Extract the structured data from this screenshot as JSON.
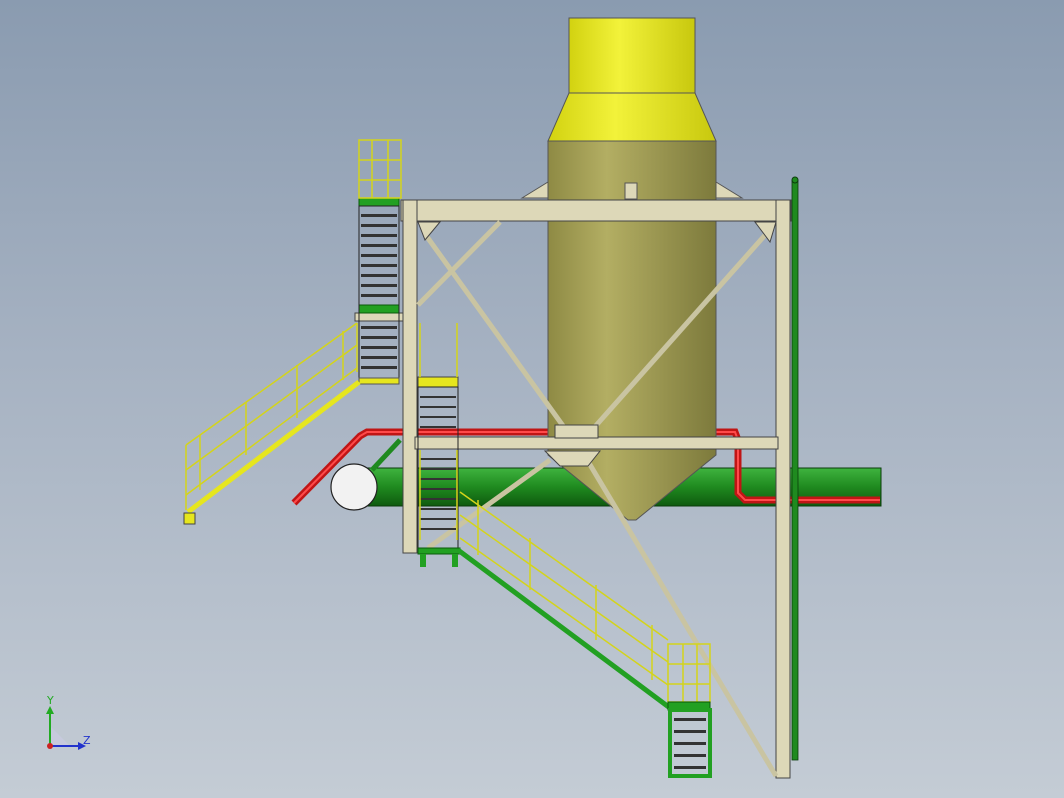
{
  "viewport": {
    "background_top": "#8a9bb0",
    "background_bottom": "#c4ccd5"
  },
  "model": {
    "colors": {
      "vessel_top": "#e8e81a",
      "vessel_body": "#a9a45a",
      "frame": "#ddd8b8",
      "pipe_green": "#1f8a1f",
      "pipe_red": "#d01818",
      "handrail": "#e6e61e",
      "stair_green": "#22a022"
    }
  },
  "axis_triad": {
    "y_label": "Y",
    "z_label": "Z",
    "y_color": "#22aa22",
    "z_color": "#2233cc",
    "origin_color": "#cc2222"
  }
}
